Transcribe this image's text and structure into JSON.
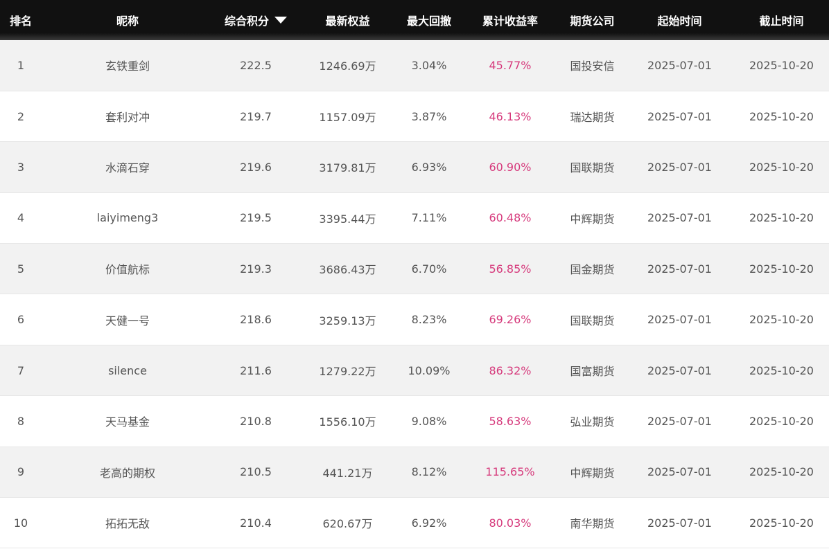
{
  "header": {
    "rank": "排名",
    "nickname": "昵称",
    "score": "综合积分",
    "equity": "最新权益",
    "drawdown": "最大回撤",
    "return": "累计收益率",
    "company": "期货公司",
    "start": "起始时间",
    "end": "截止时间"
  },
  "colors": {
    "header_bg": "#111111",
    "return_text": "#d63a7c",
    "row_alt": "#f2f2f2",
    "text": "#555555"
  },
  "rows": [
    {
      "rank": "1",
      "nickname": "玄铁重剑",
      "score": "222.5",
      "equity": "1246.69万",
      "drawdown": "3.04%",
      "return": "45.77%",
      "company": "国投安信",
      "start": "2025-07-01",
      "end": "2025-10-20"
    },
    {
      "rank": "2",
      "nickname": "套利对冲",
      "score": "219.7",
      "equity": "1157.09万",
      "drawdown": "3.87%",
      "return": "46.13%",
      "company": "瑞达期货",
      "start": "2025-07-01",
      "end": "2025-10-20"
    },
    {
      "rank": "3",
      "nickname": "水滴石穿",
      "score": "219.6",
      "equity": "3179.81万",
      "drawdown": "6.93%",
      "return": "60.90%",
      "company": "国联期货",
      "start": "2025-07-01",
      "end": "2025-10-20"
    },
    {
      "rank": "4",
      "nickname": "laiyimeng3",
      "score": "219.5",
      "equity": "3395.44万",
      "drawdown": "7.11%",
      "return": "60.48%",
      "company": "中辉期货",
      "start": "2025-07-01",
      "end": "2025-10-20"
    },
    {
      "rank": "5",
      "nickname": "价值航标",
      "score": "219.3",
      "equity": "3686.43万",
      "drawdown": "6.70%",
      "return": "56.85%",
      "company": "国金期货",
      "start": "2025-07-01",
      "end": "2025-10-20"
    },
    {
      "rank": "6",
      "nickname": "天健一号",
      "score": "218.6",
      "equity": "3259.13万",
      "drawdown": "8.23%",
      "return": "69.26%",
      "company": "国联期货",
      "start": "2025-07-01",
      "end": "2025-10-20"
    },
    {
      "rank": "7",
      "nickname": "silence",
      "score": "211.6",
      "equity": "1279.22万",
      "drawdown": "10.09%",
      "return": "86.32%",
      "company": "国富期货",
      "start": "2025-07-01",
      "end": "2025-10-20"
    },
    {
      "rank": "8",
      "nickname": "天马基金",
      "score": "210.8",
      "equity": "1556.10万",
      "drawdown": "9.08%",
      "return": "58.63%",
      "company": "弘业期货",
      "start": "2025-07-01",
      "end": "2025-10-20"
    },
    {
      "rank": "9",
      "nickname": "老高的期权",
      "score": "210.5",
      "equity": "441.21万",
      "drawdown": "8.12%",
      "return": "115.65%",
      "company": "中辉期货",
      "start": "2025-07-01",
      "end": "2025-10-20"
    },
    {
      "rank": "10",
      "nickname": "拓拓无敌",
      "score": "210.4",
      "equity": "620.67万",
      "drawdown": "6.92%",
      "return": "80.03%",
      "company": "南华期货",
      "start": "2025-07-01",
      "end": "2025-10-20"
    }
  ]
}
